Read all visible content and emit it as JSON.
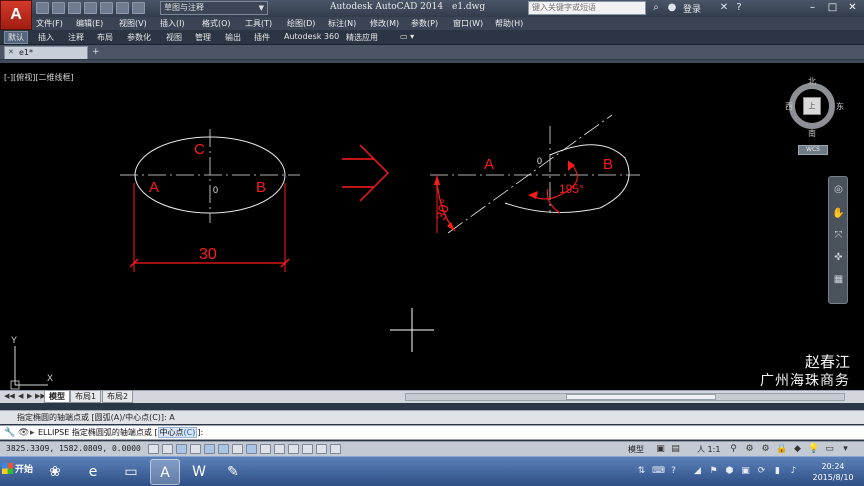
{
  "titlebar": {
    "app_logo": "A",
    "workspace": "草图与注释",
    "app_title": "Autodesk AutoCAD 2014",
    "file_name": "e1.dwg",
    "search_placeholder": "键入关键字或短语",
    "login": "登录"
  },
  "menu": {
    "items": [
      "文件(F)",
      "编辑(E)",
      "视图(V)",
      "插入(I)",
      "格式(O)",
      "工具(T)",
      "绘图(D)",
      "标注(N)",
      "修改(M)",
      "参数(P)",
      "窗口(W)",
      "帮助(H)"
    ]
  },
  "ribbon": {
    "tabs": [
      "默认",
      "插入",
      "注释",
      "布局",
      "参数化",
      "视图",
      "管理",
      "输出",
      "插件",
      "Autodesk 360",
      "精选应用"
    ]
  },
  "document": {
    "tab_name": "e1*"
  },
  "viewport": {
    "label": "[-][俯视][二维线框]",
    "annotations": {
      "left_c": "C",
      "left_a": "A",
      "left_b": "B",
      "left_center_mark": "0",
      "dim_30": "30",
      "right_a": "A",
      "right_b": "B",
      "right_center_mark": "0",
      "angle_30": "30°",
      "angle_195": "195°"
    },
    "watermark_line1": "赵春江",
    "watermark_line2": "广州海珠商务",
    "ucs_y": "Y",
    "ucs_x": "X"
  },
  "viewcube": {
    "north": "北",
    "south": "南",
    "west": "西",
    "east": "东",
    "top": "上",
    "wcs": "WCS"
  },
  "layout_tabs": [
    "模型",
    "布局1",
    "布局2"
  ],
  "command": {
    "history": "指定椭圆的轴端点或 [圆弧(A)/中心点(C)]: A",
    "prompt_prefix": "ELLIPSE 指定椭圆弧的轴端点或 [",
    "prompt_option": "中心点",
    "prompt_option_key": "(C)",
    "prompt_suffix": "]:"
  },
  "status": {
    "coordinates": "3825.3309, 1582.0809, 0.0000",
    "model": "模型",
    "scale": "人 1:1"
  },
  "taskbar": {
    "start": "开始",
    "time": "20:24",
    "date": "2015/8/10"
  },
  "colors": {
    "canvas_bg": "#000000",
    "geometry": "#ffffff",
    "dimension_red": "#ff1a1a",
    "titlebar": "#3d4758"
  }
}
